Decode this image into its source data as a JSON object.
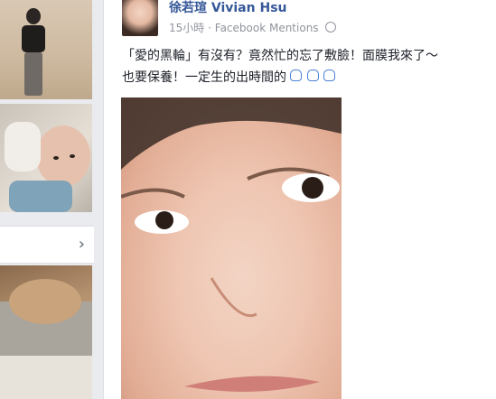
{
  "post": {
    "author": "徐若瑄 Vivian Hsu",
    "time": "15小時",
    "separator": "·",
    "via": "Facebook Mentions",
    "text_line1": "「愛的黑輪」有沒有？竟然忙的忘了敷臉！面膜我來了～",
    "text_line2": "也要保養！一定生的出時間的"
  },
  "sidebar": {
    "see_more_icon": "chevron-right-icon"
  },
  "colors": {
    "link": "#365899",
    "meta": "#90949c",
    "text": "#1d2129",
    "background": "#e9ebee"
  }
}
